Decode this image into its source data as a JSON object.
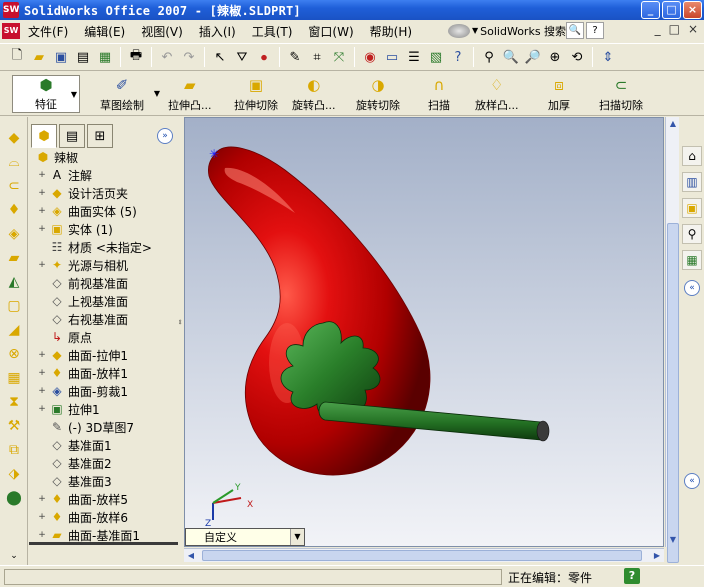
{
  "window": {
    "title": "SolidWorks Office 2007 - [辣椒.SLDPRT]",
    "app_icon": "solidworks-icon",
    "controls": [
      "_",
      "□",
      "×"
    ]
  },
  "menubar": {
    "items": [
      "文件(F)",
      "编辑(E)",
      "视图(V)",
      "插入(I)",
      "工具(T)",
      "窗口(W)",
      "帮助(H)"
    ],
    "search_label": "SolidWorks 搜索",
    "right_controls": [
      "_",
      "□",
      "×"
    ]
  },
  "toolbar_features": {
    "feature_tab": "特征",
    "sketch_tab": "草图绘制",
    "tools": [
      "拉伸凸...",
      "拉伸切除",
      "旋转凸...",
      "旋转切除",
      "扫描",
      "放样凸...",
      "加厚",
      "扫描切除"
    ]
  },
  "feature_tree": {
    "root": "辣椒",
    "items": [
      {
        "label": "注解",
        "expandable": true,
        "icon": "annotation-icon"
      },
      {
        "label": "设计活页夹",
        "expandable": true,
        "icon": "binder-icon"
      },
      {
        "label": "曲面实体 (5)",
        "expandable": true,
        "icon": "surface-body-icon"
      },
      {
        "label": "实体 (1)",
        "expandable": true,
        "icon": "solid-body-icon"
      },
      {
        "label": "材质 <未指定>",
        "expandable": false,
        "icon": "material-icon"
      },
      {
        "label": "光源与相机",
        "expandable": true,
        "icon": "lights-icon"
      },
      {
        "label": "前视基准面",
        "expandable": false,
        "icon": "plane-icon"
      },
      {
        "label": "上视基准面",
        "expandable": false,
        "icon": "plane-icon"
      },
      {
        "label": "右视基准面",
        "expandable": false,
        "icon": "plane-icon"
      },
      {
        "label": "原点",
        "expandable": false,
        "icon": "origin-icon"
      },
      {
        "label": "曲面-拉伸1",
        "expandable": true,
        "icon": "surface-extrude-icon"
      },
      {
        "label": "曲面-放样1",
        "expandable": true,
        "icon": "surface-loft-icon"
      },
      {
        "label": "曲面-剪裁1",
        "expandable": true,
        "icon": "surface-trim-icon"
      },
      {
        "label": "拉伸1",
        "expandable": true,
        "icon": "extrude-icon"
      },
      {
        "label": "(-) 3D草图7",
        "expandable": false,
        "icon": "sketch-3d-icon"
      },
      {
        "label": "基准面1",
        "expandable": false,
        "icon": "plane-icon"
      },
      {
        "label": "基准面2",
        "expandable": false,
        "icon": "plane-icon"
      },
      {
        "label": "基准面3",
        "expandable": false,
        "icon": "plane-icon"
      },
      {
        "label": "曲面-放样5",
        "expandable": true,
        "icon": "surface-loft-icon"
      },
      {
        "label": "曲面-放样6",
        "expandable": true,
        "icon": "surface-loft-icon"
      },
      {
        "label": "曲面-基准面1",
        "expandable": true,
        "icon": "surface-plane-icon"
      }
    ]
  },
  "viewport": {
    "triad": {
      "x": "X",
      "y": "Y",
      "z": "Z"
    },
    "config": "自定义",
    "colors": {
      "pepper": "#c40000",
      "calyx": "#1f6e1f"
    }
  },
  "status": {
    "text": "正在编辑：零件",
    "help": "?"
  }
}
